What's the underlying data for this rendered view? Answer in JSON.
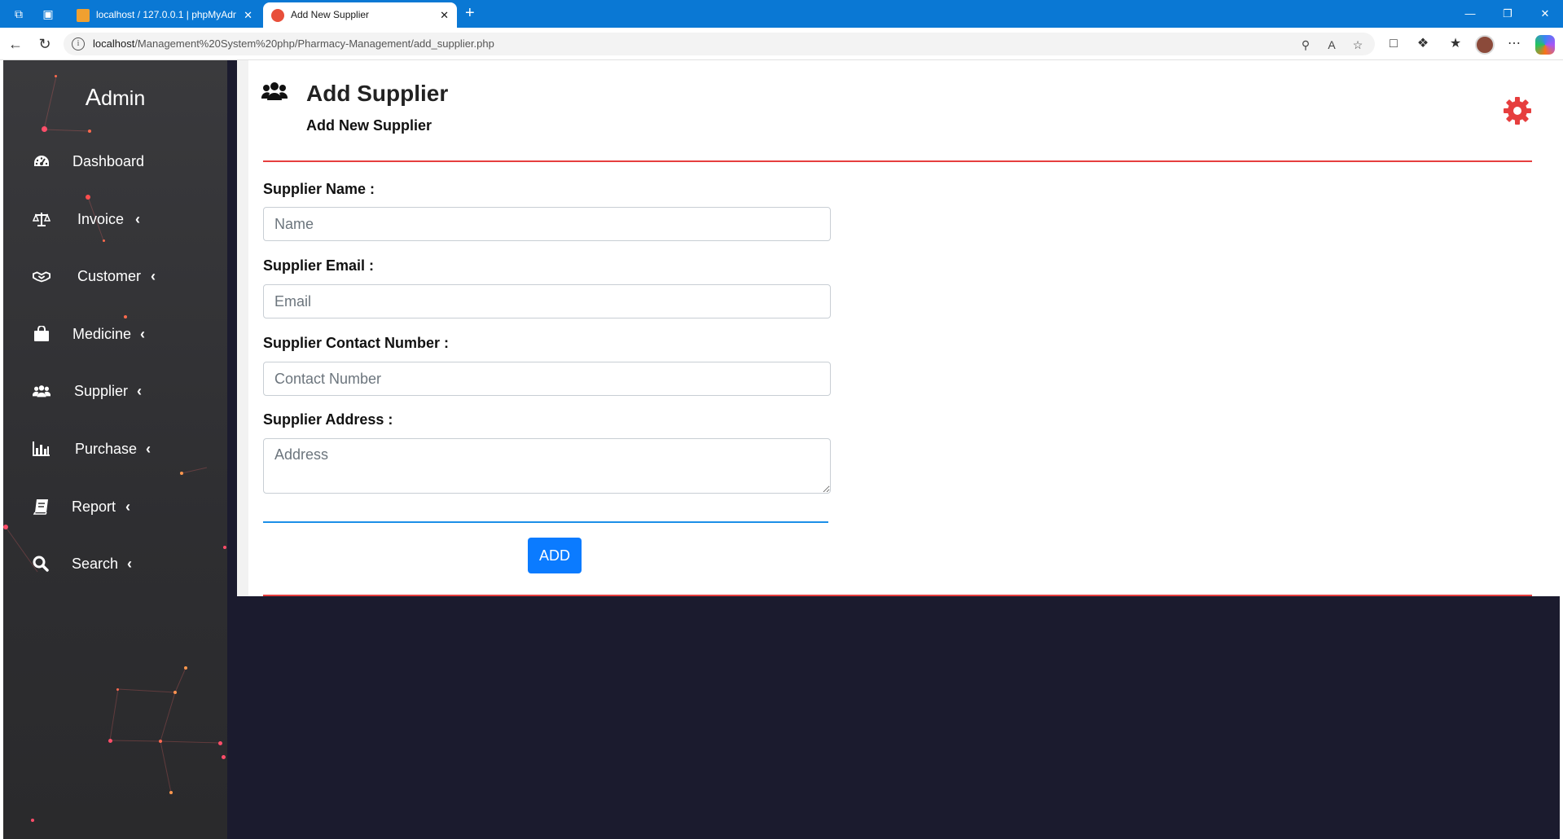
{
  "browser": {
    "tabs": [
      {
        "label": "localhost / 127.0.0.1 | phpMyAdmin",
        "active": false
      },
      {
        "label": "Add New Supplier",
        "active": true
      }
    ],
    "url_host": "localhost",
    "url_path": "/Management%20System%20php/Pharmacy-Management/add_supplier.php"
  },
  "sidebar": {
    "brand_initial": "A",
    "brand_rest": "dmin",
    "items": [
      {
        "label": "Dashboard",
        "icon": "dashboard-icon",
        "has_chevron": false
      },
      {
        "label": "Invoice",
        "icon": "balance-scale-icon",
        "has_chevron": true
      },
      {
        "label": "Customer",
        "icon": "handshake-icon",
        "has_chevron": true
      },
      {
        "label": "Medicine",
        "icon": "shopping-bag-icon",
        "has_chevron": true
      },
      {
        "label": "Supplier",
        "icon": "users-icon",
        "has_chevron": true
      },
      {
        "label": "Purchase",
        "icon": "bar-chart-icon",
        "has_chevron": true
      },
      {
        "label": "Report",
        "icon": "book-icon",
        "has_chevron": true
      },
      {
        "label": "Search",
        "icon": "search-icon",
        "has_chevron": true
      }
    ],
    "chevron": "‹"
  },
  "header": {
    "title": "Add Supplier",
    "subtitle": "Add New Supplier"
  },
  "form": {
    "name_label": "Supplier Name :",
    "name_placeholder": "Name",
    "email_label": "Supplier Email :",
    "email_placeholder": "Email",
    "contact_label": "Supplier Contact Number :",
    "contact_placeholder": "Contact Number",
    "address_label": "Supplier Address :",
    "address_placeholder": "Address",
    "submit_label": "ADD"
  },
  "colors": {
    "accent_red": "#e63e3e",
    "button_blue": "#0b7bff",
    "sidebar_bg": "#333336",
    "content_bg": "#1b1b2e"
  }
}
